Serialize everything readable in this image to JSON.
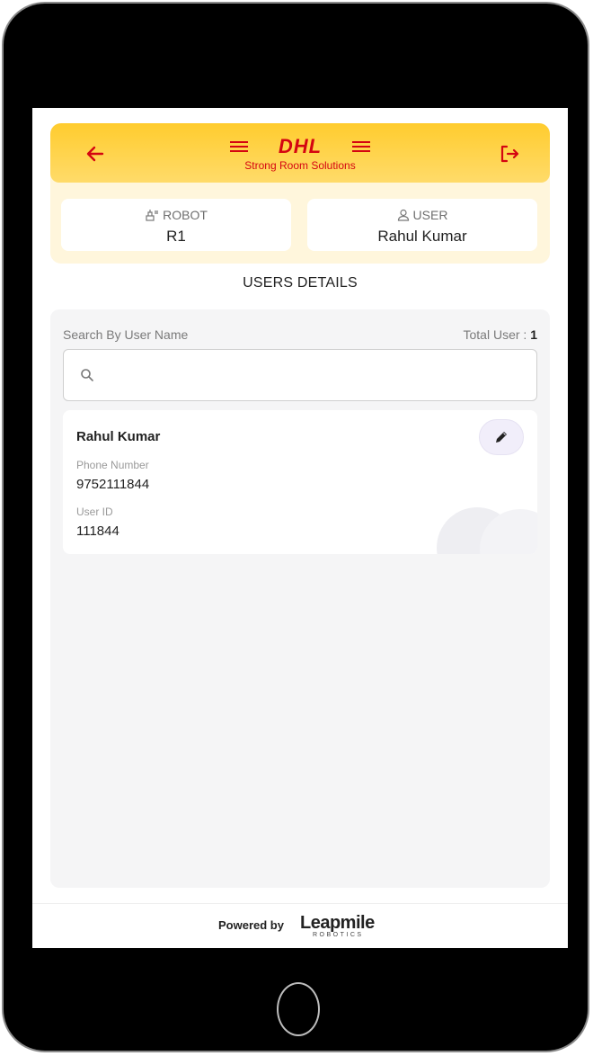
{
  "header": {
    "logo_text": "DHL",
    "subtitle": "Strong Room Solutions"
  },
  "robot": {
    "label": "ROBOT",
    "value": "R1"
  },
  "user": {
    "label": "USER",
    "value": "Rahul Kumar"
  },
  "section_title": "USERS DETAILS",
  "search": {
    "label": "Search By User Name",
    "total_label": "Total User :",
    "total_value": "1",
    "value": "",
    "placeholder": ""
  },
  "users": [
    {
      "name": "Rahul Kumar",
      "phone_label": "Phone Number",
      "phone": "9752111844",
      "id_label": "User ID",
      "user_id": "111844"
    }
  ],
  "footer": {
    "powered_by": "Powered by",
    "brand": "Leapmile",
    "brand_sub": "ROBOTICS"
  },
  "colors": {
    "accent_yellow": "#ffcc33",
    "dhl_red": "#d40511",
    "panel_bg": "#f5f5f6"
  },
  "icons": [
    "back-arrow-icon",
    "logout-icon",
    "robot-icon",
    "user-icon",
    "search-icon",
    "pencil-icon"
  ]
}
